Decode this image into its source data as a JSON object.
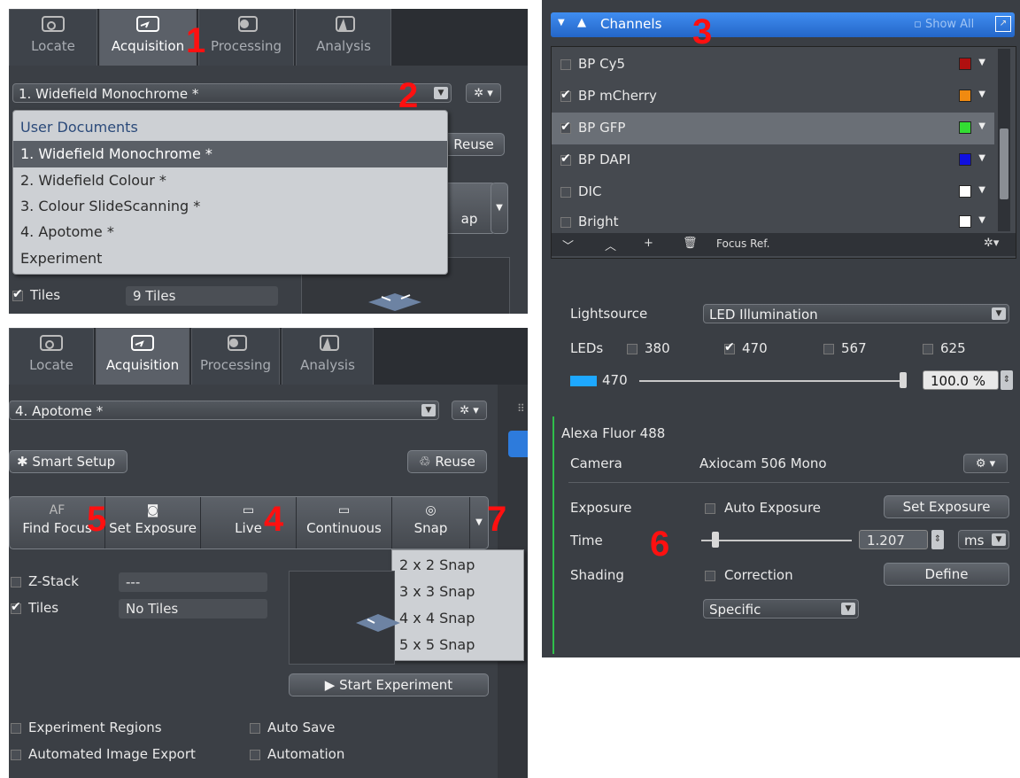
{
  "labels": {
    "n1": "1",
    "n2": "2",
    "n3": "3",
    "n4": "4",
    "n5": "5",
    "n6": "6",
    "n7": "7"
  },
  "tabs": [
    {
      "label": "Locate",
      "icon": "locate-icon"
    },
    {
      "label": "Acquisition",
      "icon": "acquisition-icon"
    },
    {
      "label": "Processing",
      "icon": "processing-icon"
    },
    {
      "label": "Analysis",
      "icon": "analysis-icon"
    }
  ],
  "panel1": {
    "document_select": "1. Widefield Monochrome *",
    "reuse": "Reuse",
    "snap_partial": "ap",
    "dropdown": {
      "header": "User Documents",
      "items": [
        "1. Widefield Monochrome *",
        "2. Widefield Colour *",
        "3. Colour SlideScanning *",
        "4. Apotome *",
        "Experiment"
      ]
    },
    "tiles_label": "Tiles",
    "tiles_value": "9 Tiles"
  },
  "panel2": {
    "document_select": "4. Apotome *",
    "smart_setup": "Smart Setup",
    "reuse": "Reuse",
    "modes": [
      {
        "icon_text": "AF",
        "label": "Find Focus"
      },
      {
        "icon_text": "",
        "label": "Set Exposure"
      },
      {
        "icon_text": "",
        "label": "Live"
      },
      {
        "icon_text": "",
        "label": "Continuous"
      },
      {
        "icon_text": "",
        "label": "Snap"
      }
    ],
    "snap_menu": [
      "2 x 2 Snap",
      "3 x 3 Snap",
      "4 x 4 Snap",
      "5 x 5 Snap"
    ],
    "zstack_label": "Z-Stack",
    "zstack_value": "---",
    "tiles_label": "Tiles",
    "tiles_value": "No Tiles",
    "start_experiment": "Start Experiment",
    "experiment_regions": "Experiment Regions",
    "auto_save": "Auto Save",
    "automated_image_export": "Automated Image Export",
    "automation": "Automation"
  },
  "panel3": {
    "header": "Channels",
    "show_all": "Show All",
    "channels": [
      {
        "name": "BP Cy5",
        "checked": false,
        "color": "#b01010"
      },
      {
        "name": "BP mCherry",
        "checked": true,
        "color": "#f08a10"
      },
      {
        "name": "BP GFP",
        "checked": true,
        "color": "#33dd33"
      },
      {
        "name": "BP DAPI",
        "checked": true,
        "color": "#1010e0"
      },
      {
        "name": "DIC",
        "checked": false,
        "color": "#ffffff"
      },
      {
        "name": "Bright",
        "checked": false,
        "color": "#ffffff"
      }
    ],
    "focus_ref": "Focus Ref.",
    "lightsource_label": "Lightsource",
    "lightsource_value": "LED Illumination",
    "leds_label": "LEDs",
    "leds": [
      {
        "value": "380",
        "checked": false
      },
      {
        "value": "470",
        "checked": true
      },
      {
        "value": "567",
        "checked": false
      },
      {
        "value": "625",
        "checked": false
      }
    ],
    "led_active": "470",
    "led_intensity": "100.0 %",
    "led_intensity_level": 1.0,
    "dye": "Alexa Fluor 488",
    "camera_label": "Camera",
    "camera_value": "Axiocam 506  Mono",
    "exposure_label": "Exposure",
    "auto_exposure": "Auto Exposure",
    "set_exposure": "Set Exposure",
    "time_label": "Time",
    "time_value": "1.207",
    "time_unit": "ms",
    "shading_label": "Shading",
    "correction": "Correction",
    "define": "Define",
    "specific": "Specific"
  }
}
